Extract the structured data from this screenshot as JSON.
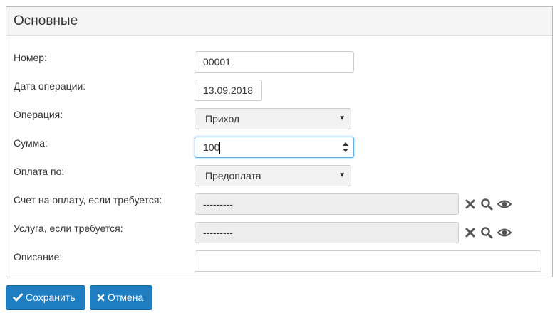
{
  "panel": {
    "title": "Основные"
  },
  "form": {
    "number": {
      "label": "Номер:",
      "value": "00001"
    },
    "date": {
      "label": "Дата операции:",
      "value": "13.09.2018"
    },
    "operation": {
      "label": "Операция:",
      "value": "Приход"
    },
    "amount": {
      "label": "Сумма:",
      "value": "100"
    },
    "payment": {
      "label": "Оплата по:",
      "value": "Предоплата"
    },
    "invoice": {
      "label": "Счет на оплату, если требуется:",
      "value": "---------"
    },
    "service": {
      "label": "Услуга, если требуется:",
      "value": "---------"
    },
    "description": {
      "label": "Описание:",
      "value": ""
    }
  },
  "buttons": {
    "save_label": "Сохранить",
    "cancel_label": "Отмена"
  },
  "icons": {
    "clear": "close-icon",
    "search": "search-icon",
    "view": "eye-icon"
  },
  "colors": {
    "primary": "#1f7ec1",
    "focus": "#66afe9",
    "disabled_bg": "#eeeeee"
  }
}
